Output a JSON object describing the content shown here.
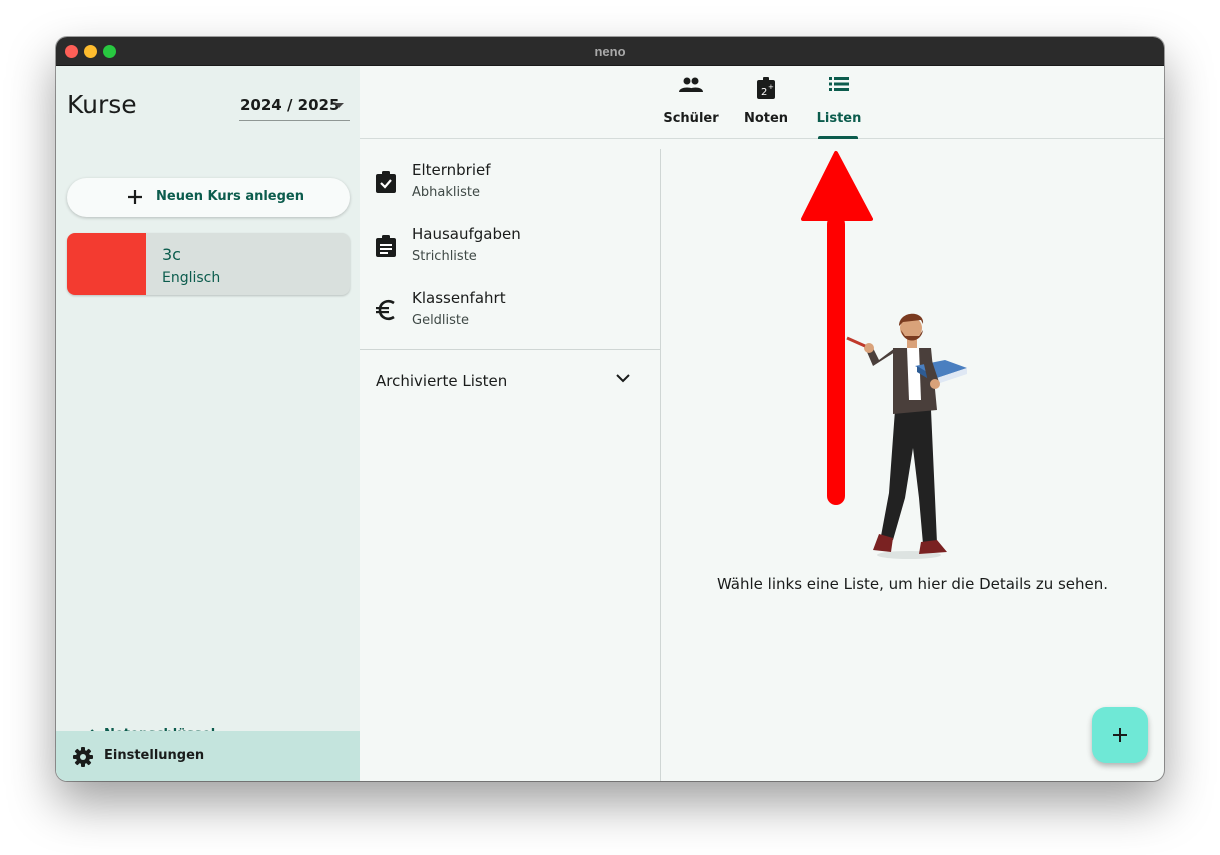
{
  "window": {
    "title": "neno"
  },
  "sidebar": {
    "title": "Kurse",
    "year": "2024 / 2025",
    "new_course_label": "Neuen Kurs anlegen",
    "courses": [
      {
        "name": "3c",
        "subject": "Englisch",
        "color": "#f33b30"
      }
    ],
    "grading_key_label": "Notenschlüssel",
    "settings_label": "Einstellungen"
  },
  "tabs": [
    {
      "label": "Schüler",
      "icon": "people-icon"
    },
    {
      "label": "Noten",
      "icon": "grade-icon"
    },
    {
      "label": "Listen",
      "icon": "list-icon",
      "selected": true
    }
  ],
  "lists": [
    {
      "name": "Elternbrief",
      "type": "Abhakliste",
      "icon": "clipboard-check-icon"
    },
    {
      "name": "Hausaufgaben",
      "type": "Strichliste",
      "icon": "clipboard-lines-icon"
    },
    {
      "name": "Klassenfahrt",
      "type": "Geldliste",
      "icon": "euro-icon"
    }
  ],
  "archived_label": "Archivierte Listen",
  "detail": {
    "empty_message": "Wähle links eine Liste, um hier die Details zu sehen."
  },
  "colors": {
    "accent": "#0c5c4d",
    "fab": "#6fe8d6",
    "annotation_arrow": "#ff0000"
  }
}
